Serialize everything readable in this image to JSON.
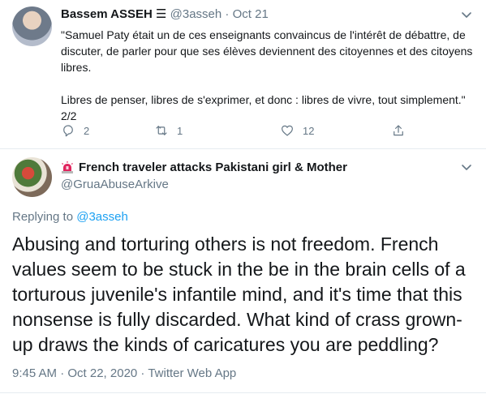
{
  "tweet1": {
    "name": "Bassem ASSEH",
    "name_suffix": " ☰",
    "handle": "@3asseh",
    "separator": " · ",
    "date": "Oct 21",
    "text_p1": "\"Samuel Paty était un de ces enseignants convaincus de l'intérêt de débattre, de discuter, de parler pour que ses élèves deviennent des citoyennes et des citoyens libres.",
    "text_p2": "Libres de penser, libres de s'exprimer, et donc : libres de vivre, tout simplement.\" 2/2",
    "reply_count": "2",
    "retweet_count": "1",
    "like_count": "12"
  },
  "tweet2": {
    "name": "French traveler attacks Pakistani girl & Mother",
    "handle": "@GruaAbuseArkive",
    "replying_prefix": "Replying to ",
    "replying_to": "@3asseh",
    "text": "Abusing and torturing others is not freedom. French values seem to be stuck in the be in the brain cells of a torturous juvenile's infantile mind, and it's time that this nonsense is fully discarded. What kind of crass grown-up draws the kinds of caricatures you are peddling?",
    "meta": "9:45 AM · Oct 22, 2020 · Twitter Web App"
  },
  "icons": {
    "reply": "reply-icon",
    "retweet": "retweet-icon",
    "like": "heart-icon",
    "share": "share-icon",
    "chevron": "chevron-down-icon",
    "siren": "siren-icon"
  },
  "colors": {
    "link": "#1da1f2",
    "muted": "#657786",
    "text": "#14171a",
    "divider": "#e6ecf0"
  }
}
